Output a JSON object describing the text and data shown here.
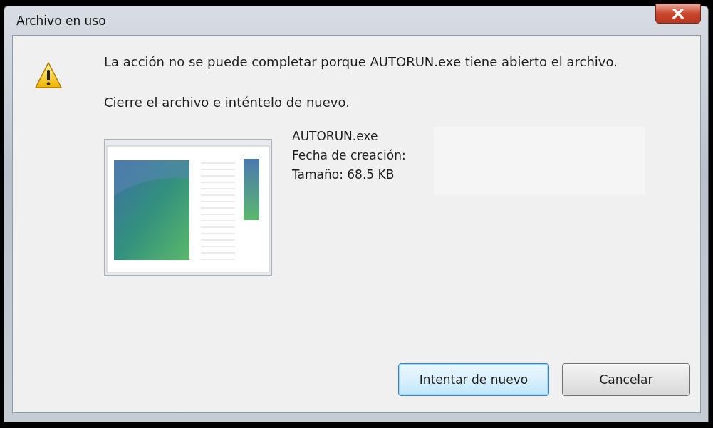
{
  "window": {
    "title": "Archivo en uso"
  },
  "message": "La acción no se puede completar porque AUTORUN.exe tiene abierto el archivo.",
  "instruction": "Cierre el archivo e inténtelo de nuevo.",
  "file": {
    "name": "AUTORUN.exe",
    "created": "Fecha de creación:",
    "size": "Tamaño: 68.5 KB"
  },
  "buttons": [
    {
      "label": "Intentar de nuevo",
      "default": true
    },
    {
      "label": "Cancelar",
      "default": false
    }
  ]
}
